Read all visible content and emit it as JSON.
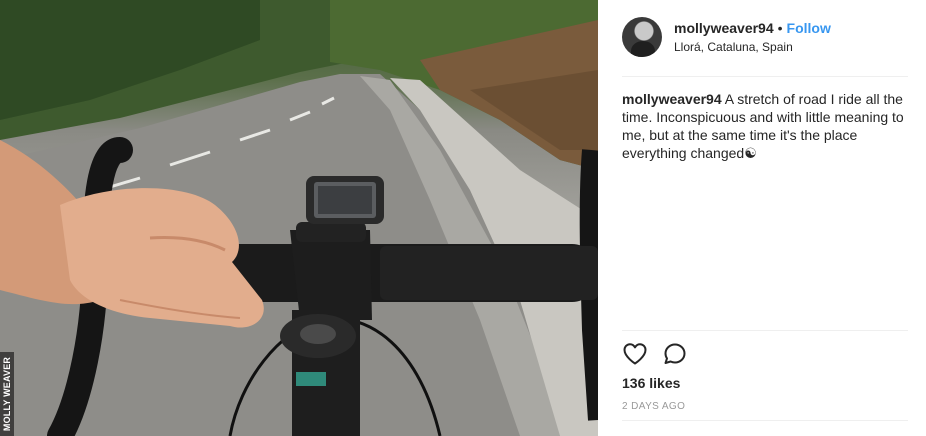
{
  "photo": {
    "credit": "MOLLY WEAVER"
  },
  "post": {
    "username": "mollyweaver94",
    "separator": "•",
    "follow_label": "Follow",
    "location": "Llorá, Cataluna, Spain",
    "caption_user": "mollyweaver94",
    "caption_text": "A stretch of road I ride all the time. Inconspicuous and with little meaning to me, but at the same time it's the place everything changed☯",
    "likes": "136 likes",
    "timestamp": "2 DAYS AGO"
  },
  "icons": {
    "like": "heart-icon",
    "comment": "comment-icon"
  },
  "colors": {
    "follow": "#3897f0",
    "text": "#262626",
    "muted": "#999999",
    "divider": "#efefef"
  }
}
